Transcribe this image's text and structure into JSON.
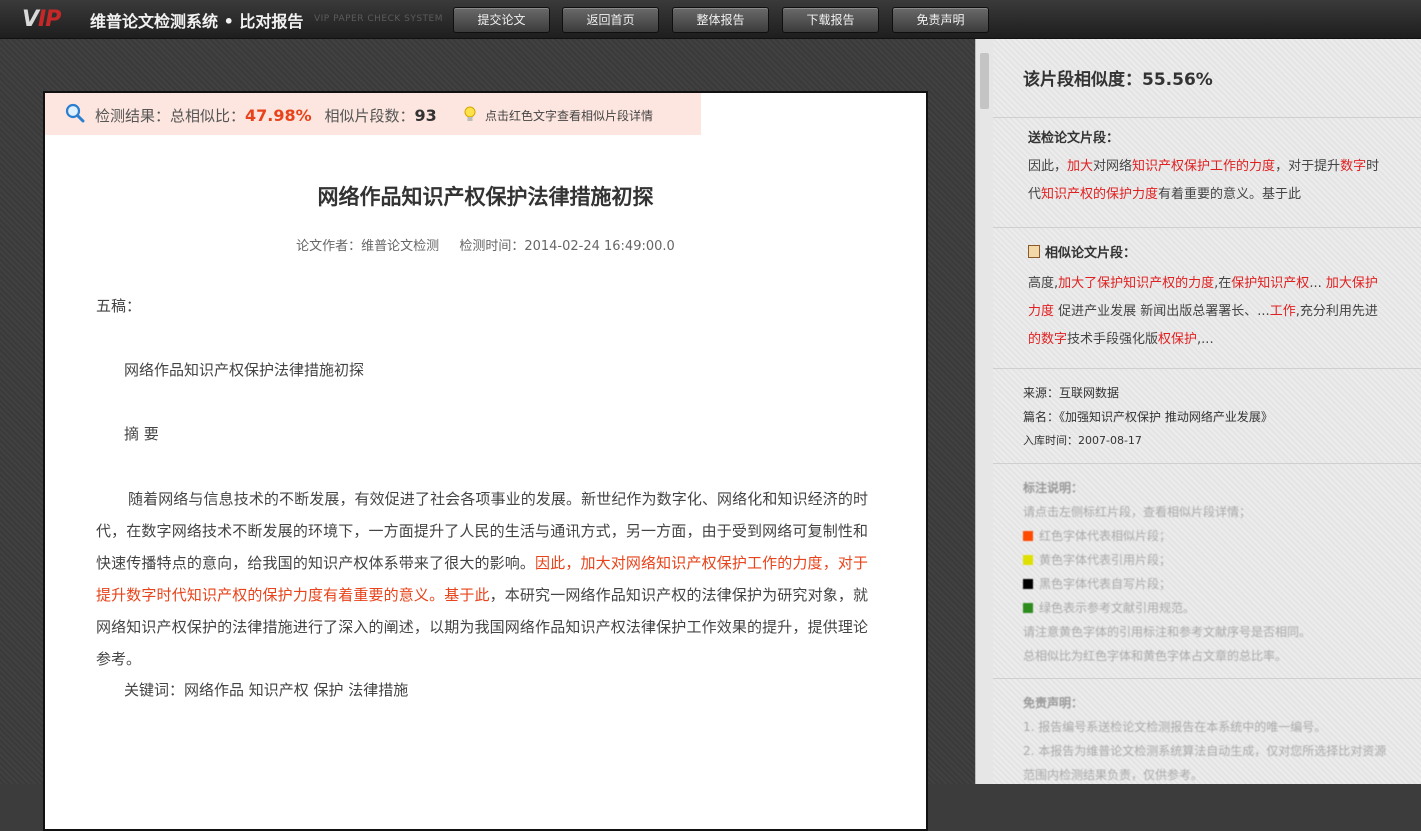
{
  "app": {
    "logo_text": "V",
    "logo_text_2": "IP",
    "title": "维普论文检测系统 • 比对报告",
    "subtitle": "VIP PAPER CHECK SYSTEM"
  },
  "nav": {
    "submit": "提交论文",
    "home": "返回首页",
    "full_report": "整体报告",
    "download": "下载报告",
    "disclaimer": "免责声明"
  },
  "summary": {
    "label": "检测结果：总相似比：",
    "ratio": "47.98%",
    "segments_label": "相似片段数：",
    "segments": "93",
    "hint": "点击红色文字查看相似片段详情"
  },
  "document": {
    "title": "网络作品知识产权保护法律措施初探",
    "author": "论文作者：维普论文检测",
    "time": "检测时间：2014-02-24 16:49:00.0",
    "p1": "五稿：",
    "p2": "网络作品知识产权保护法律措施初探",
    "p3": "摘 要",
    "body_a": "随着网络与信息技术的不断发展，有效促进了社会各项事业的发展。新世纪作为数字化、网络化和知识经济的时代，在数字网络技术不断发展的环境下，一方面提升了人民的生活与通讯方式，另一方面，由于受到网络可复制性和快速传播特点的意向，给我国的知识产权体系带来了很大的影响。",
    "body_red": "因此，加大对网络知识产权保护工作的力度，对于提升数字时代知识产权的保护力度有着重要的意义。基于此",
    "body_b": "，本研究一网络作品知识产权的法律保护为研究对象，就网络知识产权保护的法律措施进行了深入的阐述，以期为我国网络作品知识产权法律保护工作效果的提升，提供理论参考。",
    "keywords": "关键词：网络作品 知识产权 保护 法律措施"
  },
  "panel": {
    "similarity_label": "该片段相似度：",
    "similarity": "55.56%",
    "submitted_head": "送检论文片段：",
    "submitted": {
      "t1": "因此，",
      "r1": "加大",
      "t2": "对网络",
      "r2": "知识产权保护工作的力度",
      "t3": "，对于提升",
      "r3": "数字",
      "t4": "时代",
      "r4": "知识产权的保护力度",
      "t5": "有着重要的意义。基于此"
    },
    "similar_head": "相似论文片段：",
    "similar": {
      "t1": "高度,",
      "r1": "加大了保护知识产权的力度",
      "t2": ",在",
      "r2": "保护知识产权",
      "t3": "... ",
      "r3": "加大保护力度",
      "t4": " 促进产业发展 新闻出版总署署长、...",
      "r4": "工作",
      "t5": ",充分利用先进",
      "r5": "的数字",
      "t6": "技术手段强化版",
      "r6": "权保护",
      "t7": ",..."
    },
    "source": "来源：互联网数据",
    "article": "篇名：《加强知识产权保护 推动网络产业发展》",
    "date": "入库时间：2007-08-17",
    "legend_head": "标注说明：",
    "legend_1": "请点击左侧标红片段，查看相似片段详情；",
    "legend_red": "红色字体代表相似片段；",
    "legend_yellow": "黄色字体代表引用片段；",
    "legend_black": "黑色字体代表自写片段；",
    "legend_green": "绿色表示参考文献引用规范。",
    "legend_note1": "请注意黄色字体的引用标注和参考文献序号是否相同。",
    "legend_note2": "总相似比为红色字体和黄色字体占文章的总比率。",
    "disclaimer_head": "免责声明：",
    "disclaimer_1": "1. 报告编号系送检论文检测报告在本系统中的唯一编号。",
    "disclaimer_2": "2. 本报告为维普论文检测系统算法自动生成，仅对您所选择比对资源",
    "disclaimer_3": "范围内检测结果负责，仅供参考。",
    "colors": {
      "red": "#ff4a00",
      "yellow": "#e0e000",
      "black": "#000000",
      "green": "#2e8b1e"
    }
  }
}
